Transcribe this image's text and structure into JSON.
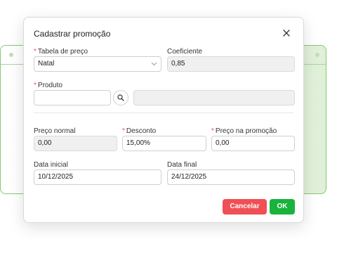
{
  "dialog": {
    "title": "Cadastrar promoção",
    "required_mark": "*"
  },
  "fields": {
    "price_table": {
      "label": "Tabela de preço",
      "value": "Natal",
      "required": true
    },
    "coefficient": {
      "label": "Coeficiente",
      "value": "0,85"
    },
    "product": {
      "label": "Produto",
      "value": "",
      "description": "",
      "required": true
    },
    "normal_price": {
      "label": "Preço normal",
      "value": "0,00"
    },
    "discount": {
      "label": "Desconto",
      "value": "15,00%",
      "required": true
    },
    "promo_price": {
      "label": "Preço na promoção",
      "value": "0,00",
      "required": true
    },
    "start_date": {
      "label": "Data inicial",
      "value": "10/12/2025"
    },
    "end_date": {
      "label": "Data final",
      "value": "24/12/2025"
    }
  },
  "buttons": {
    "cancel": "Cancelar",
    "ok": "OK"
  },
  "icons": {
    "close": "close-icon",
    "search": "search-icon",
    "dropdown": "chevron-down-icon"
  },
  "colors": {
    "cancel": "#f04f55",
    "ok": "#19b33b",
    "required": "#e25555",
    "background_window_border": "#86c77a"
  }
}
